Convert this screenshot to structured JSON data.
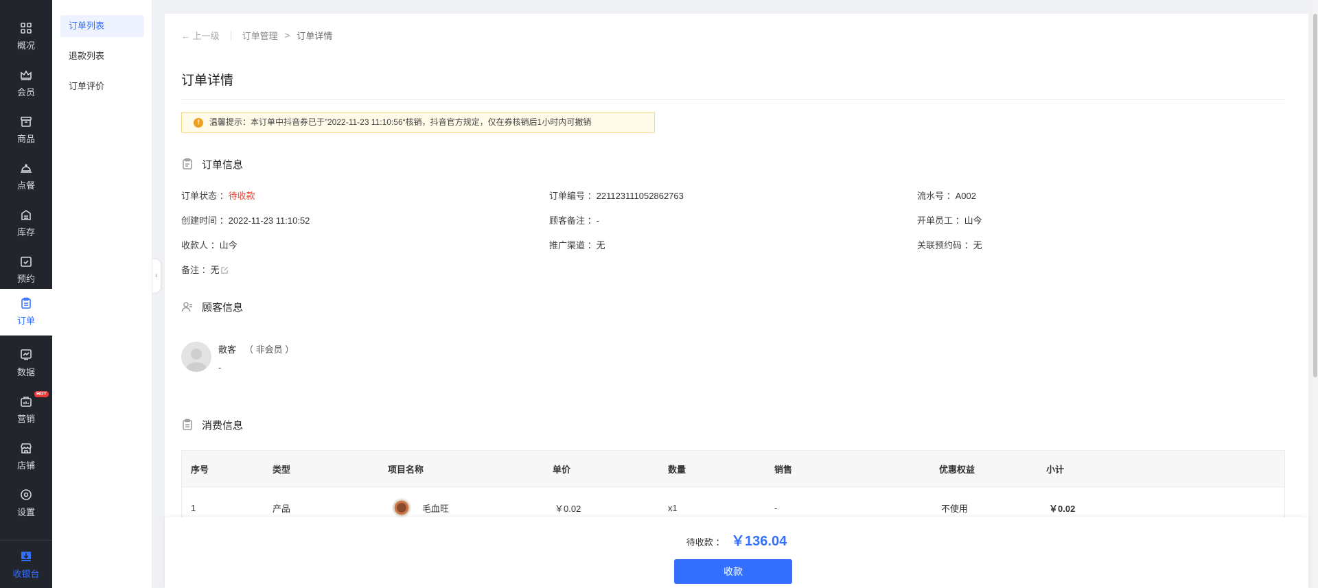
{
  "nav": {
    "items": [
      {
        "label": "概况",
        "icon": "grid-icon"
      },
      {
        "label": "会员",
        "icon": "crown-icon"
      },
      {
        "label": "商品",
        "icon": "box-icon"
      },
      {
        "label": "点餐",
        "icon": "cloche-icon"
      },
      {
        "label": "库存",
        "icon": "inventory-icon"
      },
      {
        "label": "预约",
        "icon": "calendar-check-icon"
      },
      {
        "label": "订单",
        "icon": "clipboard-icon"
      },
      {
        "label": "数据",
        "icon": "chart-icon"
      },
      {
        "label": "营销",
        "icon": "shop-bag-icon"
      },
      {
        "label": "店铺",
        "icon": "store-icon"
      },
      {
        "label": "设置",
        "icon": "gear-icon"
      }
    ],
    "hot_badge": "HOT",
    "cashier_label": "收银台"
  },
  "subnav": {
    "items": [
      "订单列表",
      "退款列表",
      "订单评价"
    ]
  },
  "breadcrumb": {
    "back": "上一级",
    "parent": "订单管理",
    "separator": ">",
    "current": "订单详情"
  },
  "page_title": "订单详情",
  "notice": {
    "text": "温馨提示：本订单中抖音券已于”2022-11-23 11:10:56“核销，抖音官方规定，仅在券核销后1小时内可撤销"
  },
  "order_info": {
    "heading": "订单信息",
    "status_label": "订单状态 ：",
    "status_value": "待收款",
    "order_no_label": "订单编号 ：",
    "order_no_value": "221123111052862763",
    "serial_label": "流水号 ：",
    "serial_value": "A002",
    "created_label": "创建时间 ：",
    "created_value": "2022-11-23 11:10:52",
    "customer_note_label": "顾客备注 ：",
    "customer_note_value": "-",
    "staff_label": "开单员工 ：",
    "staff_value": "山今",
    "cashier_label": "收款人 ：",
    "cashier_value": "山今",
    "channel_label": "推广渠道 ：",
    "channel_value": "无",
    "booking_label": "关联预约码 ：",
    "booking_value": "无",
    "remark_label": "备注 ：",
    "remark_value": "无"
  },
  "customer_info": {
    "heading": "顾客信息",
    "name": "散客",
    "type": "（ 非会员 ）",
    "sub": "-"
  },
  "consumption": {
    "heading": "消费信息",
    "columns": [
      "序号",
      "类型",
      "项目名称",
      "单价",
      "数量",
      "销售",
      "优惠权益",
      "小计"
    ],
    "rows": [
      {
        "no": "1",
        "type": "产品",
        "name": "毛血旺",
        "price": "￥0.02",
        "qty": "x1",
        "sales": "-",
        "discount": "不使用",
        "subtotal": "￥0.02"
      }
    ]
  },
  "footer": {
    "due_label": "待收款 ：",
    "due_amount": "￥136.04",
    "pay_button": "收款"
  },
  "colors": {
    "accent": "#3370ff",
    "nav_bg": "#23252c",
    "status_red": "#e8463a",
    "notice_bg": "#fffbe8"
  }
}
